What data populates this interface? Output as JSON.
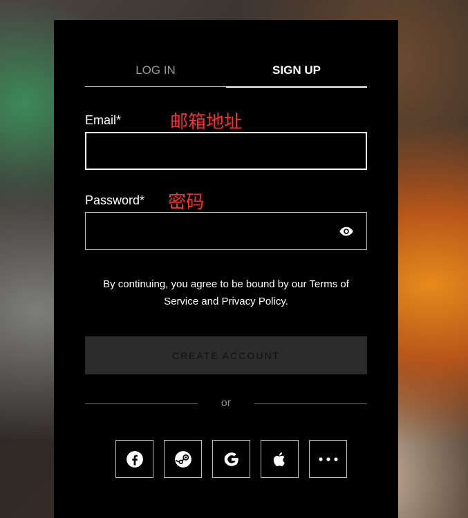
{
  "tabs": [
    {
      "label": "LOG IN",
      "active": false
    },
    {
      "label": "SIGN UP",
      "active": true
    }
  ],
  "email": {
    "label": "Email*",
    "annotation": "邮箱地址",
    "value": ""
  },
  "password": {
    "label": "Password*",
    "annotation": "密码",
    "value": ""
  },
  "terms": "By continuing, you agree to be bound by our Terms of Service and Privacy Policy.",
  "create_button": "CREATE ACCOUNT",
  "divider_text": "or",
  "social": [
    {
      "name": "facebook-icon"
    },
    {
      "name": "steam-icon"
    },
    {
      "name": "google-icon"
    },
    {
      "name": "apple-icon"
    },
    {
      "name": "more-icon"
    }
  ],
  "colors": {
    "annotation": "#ff2b2b",
    "panel": "#000000"
  }
}
